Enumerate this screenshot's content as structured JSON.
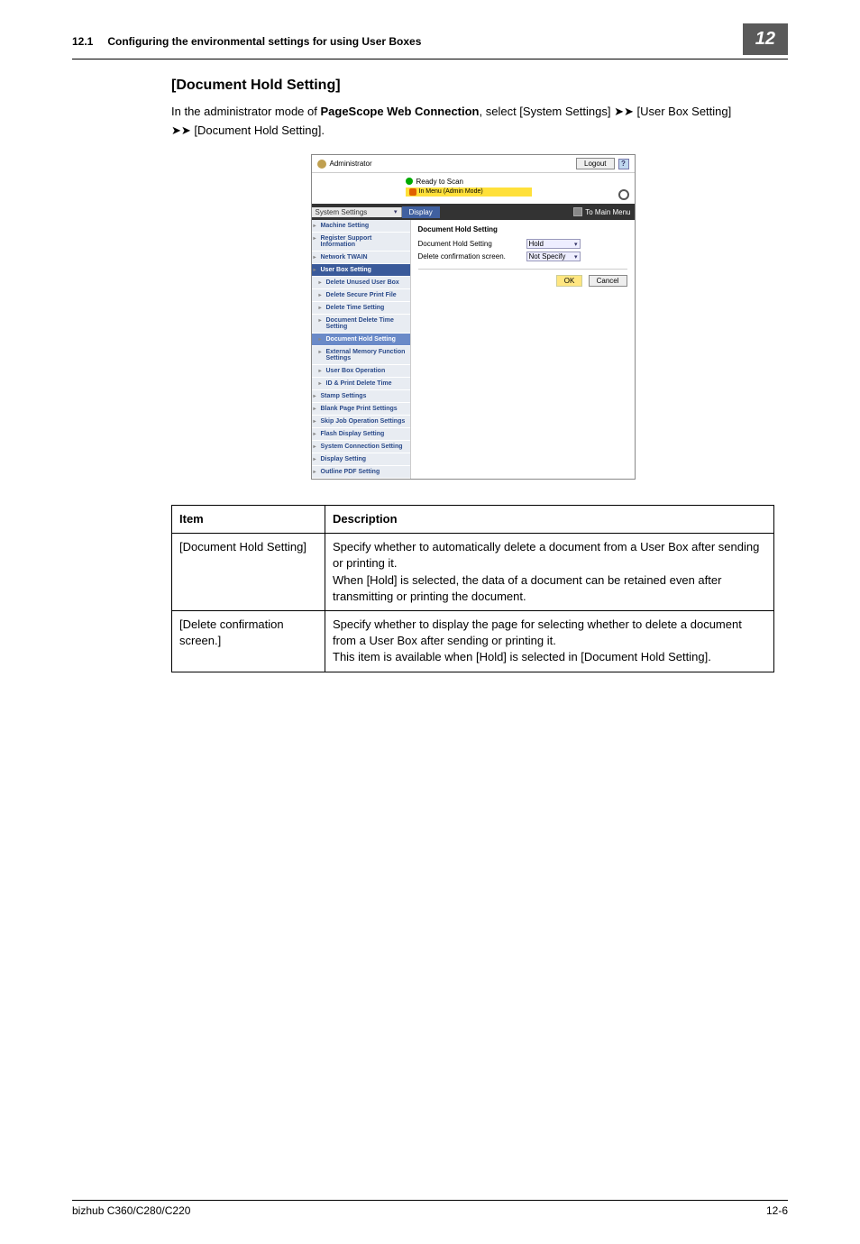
{
  "header": {
    "section_num": "12.1",
    "title": "Configuring the environmental settings for using User Boxes",
    "badge": "12"
  },
  "section_title": "[Document Hold Setting]",
  "intro": {
    "line1_pre": "In the administrator mode of ",
    "line1_bold": "PageScope Web Connection",
    "line1_post": ", select [System Settings] ",
    "line1_end": " [User Box Setting]",
    "line2_pre": " [Document Hold Setting]."
  },
  "screenshot": {
    "admin_label": "Administrator",
    "logout_label": "Logout",
    "help_label": "?",
    "status_ready": "Ready to Scan",
    "status_warn": "In Menu (Admin Mode)",
    "dropdown_value": "System Settings",
    "tab_label": "Display",
    "to_main_label": "To Main Menu",
    "sidebar": [
      {
        "label": "Machine Setting",
        "level": 0
      },
      {
        "label": "Register Support Information",
        "level": 0
      },
      {
        "label": "Network TWAIN",
        "level": 0
      },
      {
        "label": "User Box Setting",
        "level": 0,
        "state": "expanded"
      },
      {
        "label": "Delete Unused User Box",
        "level": 1
      },
      {
        "label": "Delete Secure Print File",
        "level": 1
      },
      {
        "label": "Delete Time Setting",
        "level": 1
      },
      {
        "label": "Document Delete Time Setting",
        "level": 1
      },
      {
        "label": "Document Hold Setting",
        "level": 1,
        "state": "active"
      },
      {
        "label": "External Memory Function Settings",
        "level": 1
      },
      {
        "label": "User Box Operation",
        "level": 1
      },
      {
        "label": "ID & Print Delete Time",
        "level": 1
      },
      {
        "label": "Stamp Settings",
        "level": 0
      },
      {
        "label": "Blank Page Print Settings",
        "level": 0
      },
      {
        "label": "Skip Job Operation Settings",
        "level": 0
      },
      {
        "label": "Flash Display Setting",
        "level": 0
      },
      {
        "label": "System Connection Setting",
        "level": 0
      },
      {
        "label": "Display Setting",
        "level": 0
      },
      {
        "label": "Outline PDF Setting",
        "level": 0
      }
    ],
    "main_title": "Document Hold Setting",
    "form": {
      "row1_label": "Document Hold Setting",
      "row1_value": "Hold",
      "row2_label": "Delete confirmation screen.",
      "row2_value": "Not Specify"
    },
    "ok_label": "OK",
    "cancel_label": "Cancel"
  },
  "table": {
    "header_item": "Item",
    "header_desc": "Description",
    "rows": [
      {
        "item": "[Document Hold Setting]",
        "desc": "Specify whether to automatically delete a document from a User Box after sending or printing it.\nWhen [Hold] is selected, the data of a document can be retained even after transmitting or printing the document."
      },
      {
        "item": "[Delete confirmation screen.]",
        "desc": "Specify whether to display the page for selecting whether to delete a document from a User Box after sending or printing it.\nThis item is available when [Hold] is selected in [Document Hold Setting]."
      }
    ]
  },
  "footer": {
    "model": "bizhub C360/C280/C220",
    "page": "12-6"
  }
}
